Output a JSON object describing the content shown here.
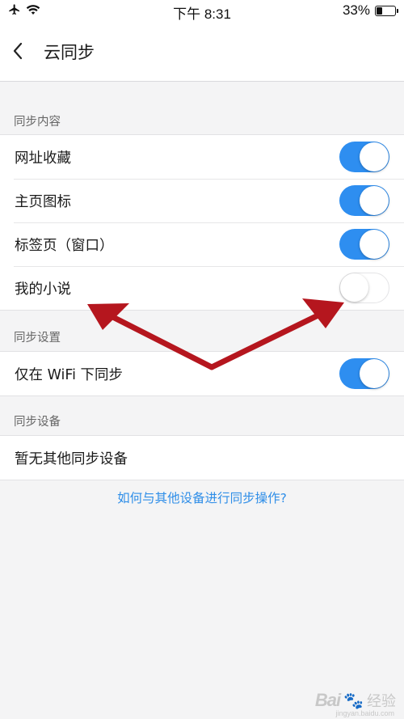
{
  "status_bar": {
    "time": "下午 8:31",
    "battery": "33%",
    "battery_level": 0.33,
    "icons": [
      "airplane-icon",
      "wifi-icon",
      "battery-icon"
    ]
  },
  "nav": {
    "back_icon": "chevron-left-icon",
    "title": "云同步"
  },
  "sections": [
    {
      "header": "同步内容",
      "rows": [
        {
          "label": "网址收藏",
          "toggle": true
        },
        {
          "label": "主页图标",
          "toggle": true
        },
        {
          "label": "标签页（窗口）",
          "toggle": true
        },
        {
          "label": "我的小说",
          "toggle": false
        }
      ]
    },
    {
      "header": "同步设置",
      "rows": [
        {
          "label": "仅在 WiFi 下同步",
          "toggle": true
        }
      ]
    },
    {
      "header": "同步设备",
      "rows": [
        {
          "label": "暂无其他同步设备"
        }
      ]
    }
  ],
  "help_link": "如何与其他设备进行同步操作?",
  "watermark": {
    "logo": "Bai",
    "word": "经验",
    "site": "jingyan.baidu.com"
  },
  "colors": {
    "accent": "#2e8ef0",
    "annotation": "#b5161e",
    "background": "#f4f4f5"
  }
}
